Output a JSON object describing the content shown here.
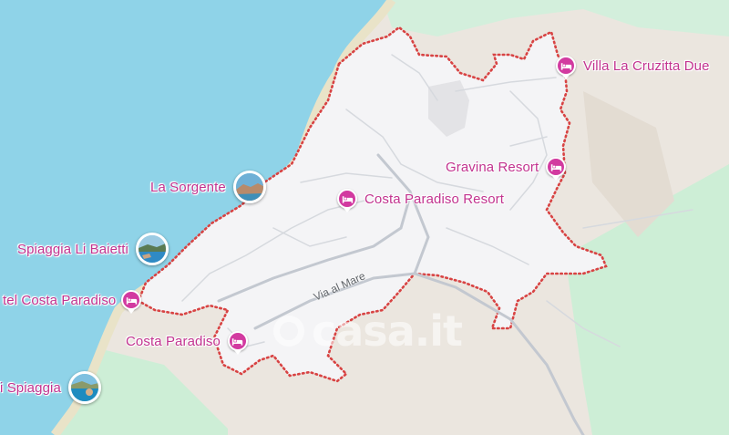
{
  "map": {
    "colors": {
      "sea": "#8fd3e8",
      "land": "#ebe6df",
      "vegetation": "#c9ecd4",
      "area": "#f4f4f6",
      "boundary": "#d84343",
      "road": "#c3c8d0",
      "poi": "#c2338f"
    },
    "watermark": "casa.it",
    "road_label": "Via al Mare",
    "hotels": [
      {
        "name": "Villa La Cruzitta Due",
        "icon": "hotel-icon"
      },
      {
        "name": "Gravina Resort",
        "icon": "hotel-icon"
      },
      {
        "name": "Costa Paradiso Resort",
        "icon": "hotel-icon"
      },
      {
        "name": "tel Costa Paradiso",
        "icon": "hotel-icon"
      },
      {
        "name": "Costa Paradiso",
        "icon": "hotel-icon"
      }
    ],
    "places": [
      {
        "name": "La Sorgente",
        "icon": "photo-thumbnail"
      },
      {
        "name": "Spiaggia Li Baietti",
        "icon": "photo-thumbnail"
      },
      {
        "name": "i Spiaggia",
        "icon": "photo-thumbnail"
      }
    ]
  }
}
